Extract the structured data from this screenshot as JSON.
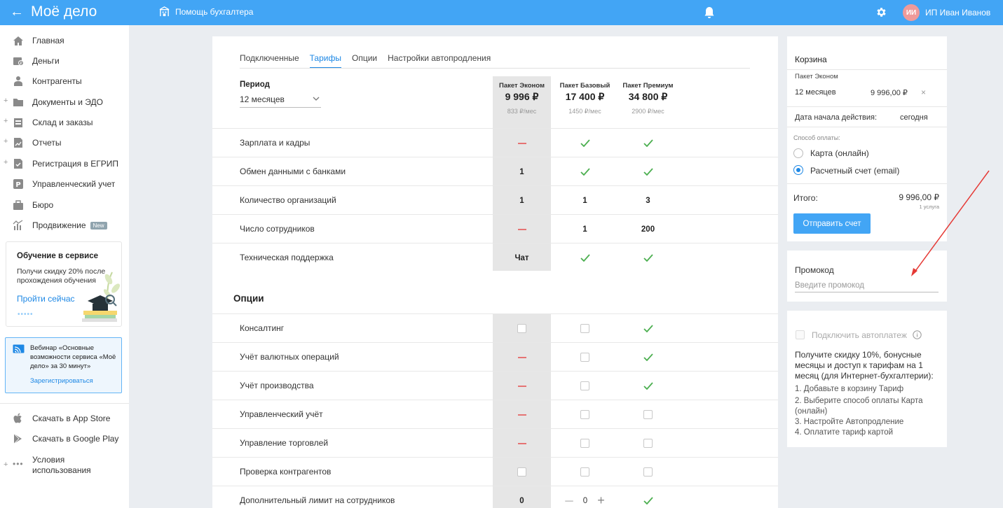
{
  "topbar": {
    "back_icon": "arrow-left-icon",
    "logo": "Моё дело",
    "help_label": "Помощь бухгалтера",
    "avatar_initials": "ИИ",
    "user_name": "ИП Иван Иванов",
    "accent_color": "#42a5f5"
  },
  "sidebar": {
    "items": [
      {
        "label": "Главная",
        "icon": "home-icon",
        "expandable": false
      },
      {
        "label": "Деньги",
        "icon": "wallet-icon",
        "expandable": false
      },
      {
        "label": "Контрагенты",
        "icon": "people-icon",
        "expandable": false
      },
      {
        "label": "Документы и ЭДО",
        "icon": "folder-icon",
        "expandable": true
      },
      {
        "label": "Склад и заказы",
        "icon": "warehouse-icon",
        "expandable": true
      },
      {
        "label": "Отчеты",
        "icon": "report-icon",
        "expandable": true
      },
      {
        "label": "Регистрация в ЕГРИП",
        "icon": "registration-icon",
        "expandable": true
      },
      {
        "label": "Управленческий учет",
        "icon": "management-icon",
        "expandable": false
      },
      {
        "label": "Бюро",
        "icon": "briefcase-icon",
        "expandable": false
      },
      {
        "label": "Продвижение",
        "icon": "chart-icon",
        "expandable": false,
        "badge": "New"
      }
    ],
    "promo": {
      "title": "Обучение в сервисе",
      "text": "Получи скидку 20% после прохождения обучения",
      "link": "Пройти сейчас",
      "dots": "•••••"
    },
    "webinar": {
      "text": "Вебинар «Основные возможности сервиса «Моё дело» за 30 минут»",
      "link": "Зарегистрироваться"
    },
    "bottom_items": [
      {
        "label": "Скачать в App Store",
        "icon": "apple-icon"
      },
      {
        "label": "Скачать в Google Play",
        "icon": "google-play-icon"
      },
      {
        "label": "Условия использования",
        "icon": "more-dots-icon"
      }
    ]
  },
  "main": {
    "tabs": [
      {
        "label": "Подключенные",
        "active": false
      },
      {
        "label": "Тарифы",
        "active": true
      },
      {
        "label": "Опции",
        "active": false
      },
      {
        "label": "Настройки автопродления",
        "active": false
      }
    ],
    "period_label": "Период",
    "period_value": "12 месяцев",
    "packages": [
      {
        "name": "Пакет Эконом",
        "price": "9 996 ₽",
        "monthly": "833 ₽/мес"
      },
      {
        "name": "Пакет Базовый",
        "price": "17 400 ₽",
        "monthly": "1450 ₽/мес"
      },
      {
        "name": "Пакет Премиум",
        "price": "34 800 ₽",
        "monthly": "2900 ₽/мес"
      }
    ],
    "features": [
      {
        "label": "Зарплата и кадры",
        "values": [
          "dash",
          "check",
          "check"
        ]
      },
      {
        "label": "Обмен данными с банками",
        "values": [
          "1",
          "check",
          "check"
        ]
      },
      {
        "label": "Количество организаций",
        "values": [
          "1",
          "1",
          "3"
        ]
      },
      {
        "label": "Число сотрудников",
        "values": [
          "dash",
          "1",
          "200"
        ]
      },
      {
        "label": "Техническая поддержка",
        "values": [
          "Чат",
          "check",
          "check"
        ]
      }
    ],
    "options_title": "Опции",
    "options": [
      {
        "label": "Консалтинг",
        "values": [
          "box",
          "box",
          "check"
        ]
      },
      {
        "label": "Учёт валютных операций",
        "values": [
          "dash",
          "box",
          "check"
        ]
      },
      {
        "label": "Учёт производства",
        "values": [
          "dash",
          "box",
          "check"
        ]
      },
      {
        "label": "Управленческий учёт",
        "values": [
          "dash",
          "box",
          "box"
        ]
      },
      {
        "label": "Управление торговлей",
        "values": [
          "dash",
          "box",
          "box"
        ]
      },
      {
        "label": "Проверка контрагентов",
        "values": [
          "box",
          "box",
          "box"
        ]
      },
      {
        "label": "Дополнительный лимит на сотрудников",
        "values": [
          "0",
          "stepper",
          "check"
        ],
        "stepper_value": "0"
      }
    ]
  },
  "cart": {
    "title": "Корзина",
    "item_name": "Пакет Эконом",
    "item_period": "12 месяцев",
    "item_price": "9 996,00 ₽",
    "remove_icon": "×",
    "start_label": "Дата начала действия:",
    "start_value": "сегодня",
    "payment_label": "Способ оплаты:",
    "payment_options": [
      {
        "label": "Карта (онлайн)",
        "selected": false
      },
      {
        "label": "Расчетный счет (email)",
        "selected": true
      }
    ],
    "total_label": "Итого:",
    "total_value": "9 996,00 ₽",
    "total_note": "1 услуга",
    "send_button": "Отправить счет"
  },
  "promo_code": {
    "label": "Промокод",
    "placeholder": "Введите промокод"
  },
  "autopay": {
    "label": "Подключить автоплатеж",
    "info_icon": "info-icon",
    "description": "Получите скидку 10%, бонусные месяцы и доступ к тарифам на 1 месяц (для Интернет-бухгалтерии):",
    "steps": [
      "1. Добавьте в корзину Тариф",
      "2. Выберите способ оплаты Карта (онлайн)",
      "3. Настройте Автопродление",
      "4. Оплатите тариф картой"
    ]
  }
}
